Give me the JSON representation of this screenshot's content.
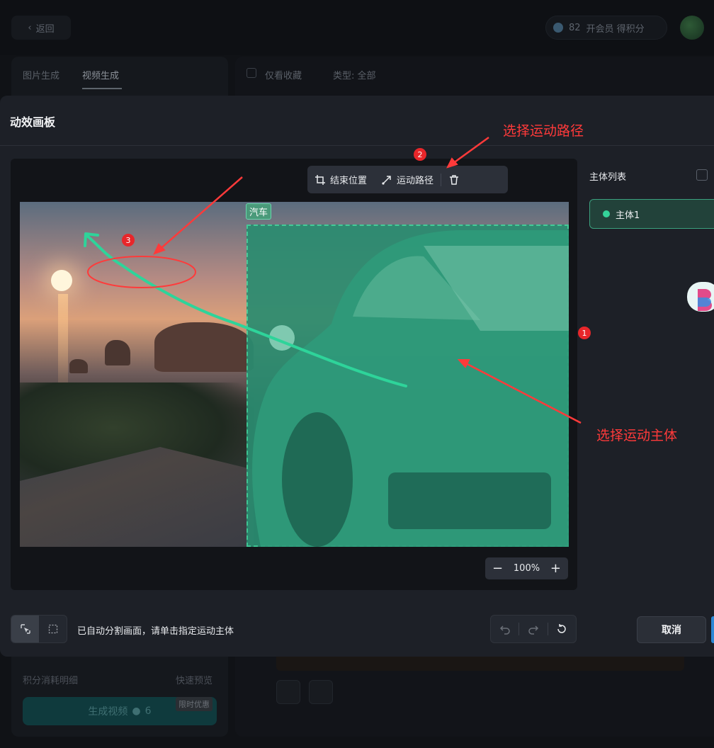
{
  "topbar": {
    "back_label": "返回",
    "points_value": "82",
    "points_action": "开会员 得积分"
  },
  "left_panel": {
    "tabs": [
      {
        "label": "图片生成"
      },
      {
        "label": "视频生成"
      }
    ],
    "points_detail": "积分消耗明细",
    "quick_preview": "快速预览",
    "generate_label": "生成视频",
    "generate_cost": "6",
    "limited_offer": "限时优惠"
  },
  "main_bg": {
    "favorites_only": "仅看收藏",
    "type_filter": "类型: 全部"
  },
  "modal": {
    "title": "动效画板",
    "toolbar": {
      "end_position": "结束位置",
      "motion_path": "运动路径"
    },
    "subject_tag": "汽车",
    "zoom_level": "100%",
    "subject_list_title": "主体列表",
    "subjects": [
      {
        "label": "主体1",
        "color": "#34d399"
      }
    ],
    "hint": "已自动分割画面，请单击指定运动主体",
    "cancel_label": "取消"
  },
  "annotations": {
    "select_path": "选择运动路径",
    "select_subject": "选择运动主体",
    "markers": [
      "1",
      "2",
      "3"
    ]
  },
  "colors": {
    "accent_green": "#34d399",
    "annotation_red": "#ff3a3a",
    "path_green": "#2ed49a"
  }
}
